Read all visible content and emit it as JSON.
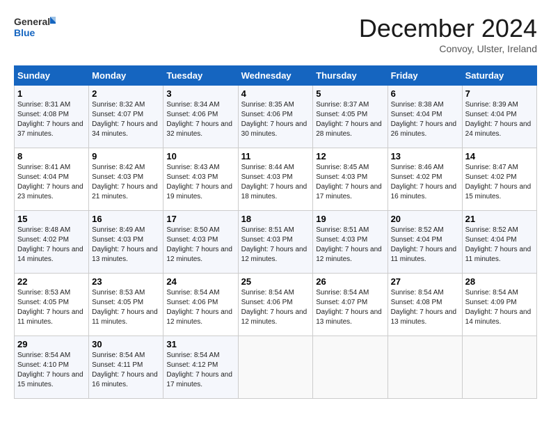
{
  "header": {
    "logo_general": "General",
    "logo_blue": "Blue",
    "month_title": "December 2024",
    "subtitle": "Convoy, Ulster, Ireland"
  },
  "days_of_week": [
    "Sunday",
    "Monday",
    "Tuesday",
    "Wednesday",
    "Thursday",
    "Friday",
    "Saturday"
  ],
  "weeks": [
    [
      {
        "day": "1",
        "sunrise": "8:31 AM",
        "sunset": "4:08 PM",
        "daylight": "7 hours and 37 minutes."
      },
      {
        "day": "2",
        "sunrise": "8:32 AM",
        "sunset": "4:07 PM",
        "daylight": "7 hours and 34 minutes."
      },
      {
        "day": "3",
        "sunrise": "8:34 AM",
        "sunset": "4:06 PM",
        "daylight": "7 hours and 32 minutes."
      },
      {
        "day": "4",
        "sunrise": "8:35 AM",
        "sunset": "4:06 PM",
        "daylight": "7 hours and 30 minutes."
      },
      {
        "day": "5",
        "sunrise": "8:37 AM",
        "sunset": "4:05 PM",
        "daylight": "7 hours and 28 minutes."
      },
      {
        "day": "6",
        "sunrise": "8:38 AM",
        "sunset": "4:04 PM",
        "daylight": "7 hours and 26 minutes."
      },
      {
        "day": "7",
        "sunrise": "8:39 AM",
        "sunset": "4:04 PM",
        "daylight": "7 hours and 24 minutes."
      }
    ],
    [
      {
        "day": "8",
        "sunrise": "8:41 AM",
        "sunset": "4:04 PM",
        "daylight": "7 hours and 23 minutes."
      },
      {
        "day": "9",
        "sunrise": "8:42 AM",
        "sunset": "4:03 PM",
        "daylight": "7 hours and 21 minutes."
      },
      {
        "day": "10",
        "sunrise": "8:43 AM",
        "sunset": "4:03 PM",
        "daylight": "7 hours and 19 minutes."
      },
      {
        "day": "11",
        "sunrise": "8:44 AM",
        "sunset": "4:03 PM",
        "daylight": "7 hours and 18 minutes."
      },
      {
        "day": "12",
        "sunrise": "8:45 AM",
        "sunset": "4:03 PM",
        "daylight": "7 hours and 17 minutes."
      },
      {
        "day": "13",
        "sunrise": "8:46 AM",
        "sunset": "4:02 PM",
        "daylight": "7 hours and 16 minutes."
      },
      {
        "day": "14",
        "sunrise": "8:47 AM",
        "sunset": "4:02 PM",
        "daylight": "7 hours and 15 minutes."
      }
    ],
    [
      {
        "day": "15",
        "sunrise": "8:48 AM",
        "sunset": "4:02 PM",
        "daylight": "7 hours and 14 minutes."
      },
      {
        "day": "16",
        "sunrise": "8:49 AM",
        "sunset": "4:03 PM",
        "daylight": "7 hours and 13 minutes."
      },
      {
        "day": "17",
        "sunrise": "8:50 AM",
        "sunset": "4:03 PM",
        "daylight": "7 hours and 12 minutes."
      },
      {
        "day": "18",
        "sunrise": "8:51 AM",
        "sunset": "4:03 PM",
        "daylight": "7 hours and 12 minutes."
      },
      {
        "day": "19",
        "sunrise": "8:51 AM",
        "sunset": "4:03 PM",
        "daylight": "7 hours and 12 minutes."
      },
      {
        "day": "20",
        "sunrise": "8:52 AM",
        "sunset": "4:04 PM",
        "daylight": "7 hours and 11 minutes."
      },
      {
        "day": "21",
        "sunrise": "8:52 AM",
        "sunset": "4:04 PM",
        "daylight": "7 hours and 11 minutes."
      }
    ],
    [
      {
        "day": "22",
        "sunrise": "8:53 AM",
        "sunset": "4:05 PM",
        "daylight": "7 hours and 11 minutes."
      },
      {
        "day": "23",
        "sunrise": "8:53 AM",
        "sunset": "4:05 PM",
        "daylight": "7 hours and 11 minutes."
      },
      {
        "day": "24",
        "sunrise": "8:54 AM",
        "sunset": "4:06 PM",
        "daylight": "7 hours and 12 minutes."
      },
      {
        "day": "25",
        "sunrise": "8:54 AM",
        "sunset": "4:06 PM",
        "daylight": "7 hours and 12 minutes."
      },
      {
        "day": "26",
        "sunrise": "8:54 AM",
        "sunset": "4:07 PM",
        "daylight": "7 hours and 13 minutes."
      },
      {
        "day": "27",
        "sunrise": "8:54 AM",
        "sunset": "4:08 PM",
        "daylight": "7 hours and 13 minutes."
      },
      {
        "day": "28",
        "sunrise": "8:54 AM",
        "sunset": "4:09 PM",
        "daylight": "7 hours and 14 minutes."
      }
    ],
    [
      {
        "day": "29",
        "sunrise": "8:54 AM",
        "sunset": "4:10 PM",
        "daylight": "7 hours and 15 minutes."
      },
      {
        "day": "30",
        "sunrise": "8:54 AM",
        "sunset": "4:11 PM",
        "daylight": "7 hours and 16 minutes."
      },
      {
        "day": "31",
        "sunrise": "8:54 AM",
        "sunset": "4:12 PM",
        "daylight": "7 hours and 17 minutes."
      },
      null,
      null,
      null,
      null
    ]
  ]
}
